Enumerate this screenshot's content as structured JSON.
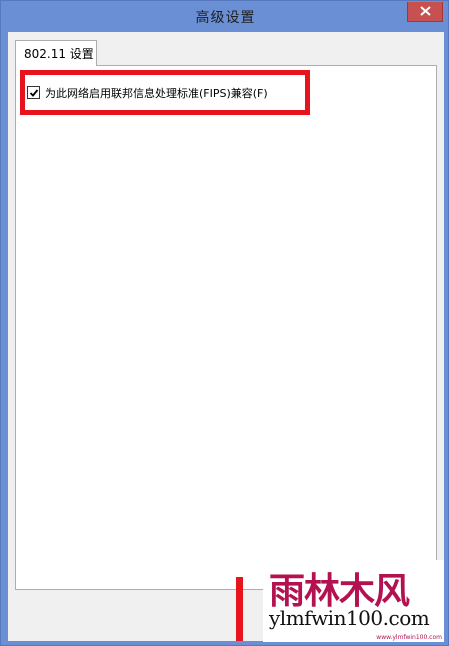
{
  "window": {
    "title": "高级设置",
    "close_icon": "close-icon"
  },
  "tabs": [
    {
      "label": "802.11 设置",
      "selected": true
    }
  ],
  "settings": {
    "fips_checkbox": {
      "label": "为此网络启用联邦信息处理标准(FIPS)兼容(F)",
      "checked": true
    }
  },
  "annotation": {
    "highlight_color": "#e8141d"
  },
  "watermark": {
    "title": "雨林木风",
    "url": "ylmfwin100.com",
    "small_text": "www.ylmfwin100.com"
  },
  "colors": {
    "frame": "#6b8fd4",
    "close_button": "#c75050",
    "client": "#f0f0f0"
  }
}
